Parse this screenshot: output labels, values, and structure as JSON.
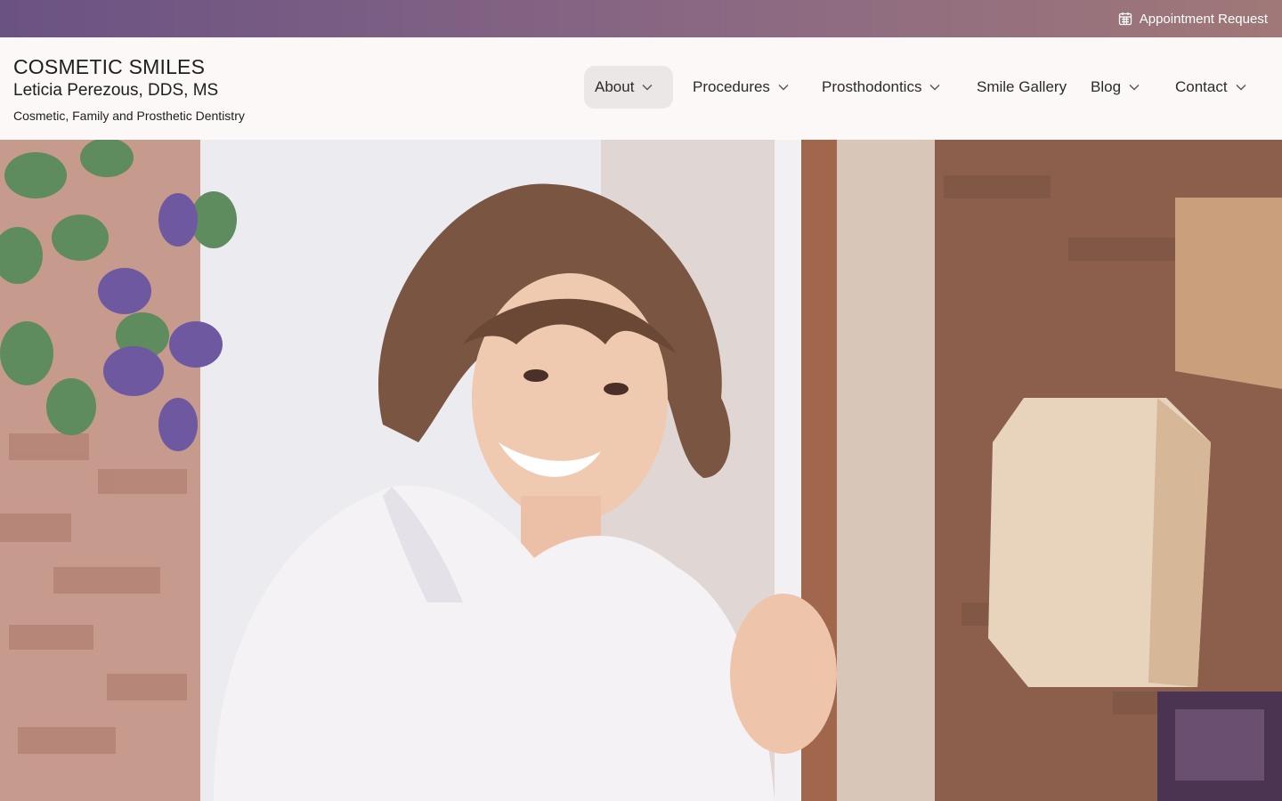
{
  "topbar": {
    "appointment_label": "Appointment Request",
    "appointment_icon": "calendar-icon"
  },
  "brand": {
    "title": "COSMETIC SMILES",
    "doctor": "Leticia Perezous, DDS, MS",
    "tagline": "Cosmetic, Family and Prosthetic Dentistry"
  },
  "nav": {
    "items": [
      {
        "label": "About",
        "has_dropdown": true,
        "active": true
      },
      {
        "label": "Procedures",
        "has_dropdown": true
      },
      {
        "label": "Prosthodontics",
        "has_dropdown": true
      },
      {
        "label": "Smile Gallery",
        "has_dropdown": false
      },
      {
        "label": "Blog",
        "has_dropdown": true
      },
      {
        "label": "Contact",
        "has_dropdown": true
      }
    ]
  },
  "hero": {
    "image": "smiling-woman-photo",
    "heading": ""
  },
  "colors": {
    "topbar_start": "#6a5283",
    "topbar_end": "#a07878",
    "active_nav_bg": "#ebe7e6",
    "text": "#2b2b2b"
  }
}
